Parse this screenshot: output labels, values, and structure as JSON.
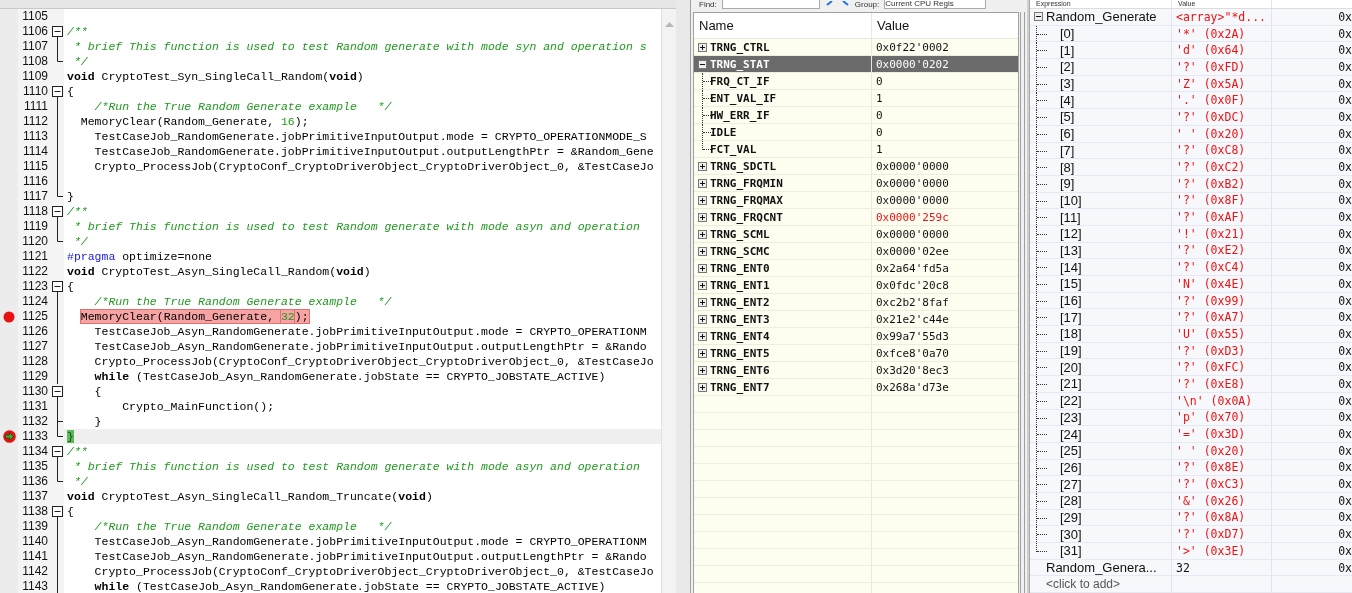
{
  "editor": {
    "lines": [
      {
        "number": "1105"
      },
      {
        "number": "1106",
        "fold": {
          "kind": "open"
        },
        "tokens": [
          {
            "kind": "comment",
            "text": "/**"
          }
        ]
      },
      {
        "number": "1107",
        "fold": {
          "kind": "line"
        },
        "tokens": [
          {
            "kind": "comment",
            "text": " * brief This function is used to test Random generate with mode syn and operation s"
          }
        ]
      },
      {
        "number": "1108",
        "fold": {
          "kind": "end"
        },
        "tokens": [
          {
            "kind": "comment",
            "text": " */"
          }
        ]
      },
      {
        "number": "1109",
        "tokens": [
          {
            "kind": "keyword",
            "text": "void"
          },
          {
            "kind": "plain",
            "text": " CryptoTest_Syn_SingleCall_Random("
          },
          {
            "kind": "keyword",
            "text": "void"
          },
          {
            "kind": "plain",
            "text": ")"
          }
        ]
      },
      {
        "number": "1110",
        "fold": {
          "kind": "open"
        },
        "tokens": [
          {
            "kind": "plain",
            "text": "{"
          }
        ]
      },
      {
        "number": "1111",
        "fold": {
          "kind": "line"
        },
        "tokens": [
          {
            "kind": "comment",
            "text": "    /*Run the True Random Generate example   */"
          }
        ]
      },
      {
        "number": "1112",
        "fold": {
          "kind": "line"
        },
        "tokens": [
          {
            "kind": "plain",
            "text": "  MemoryClear(Random_Generate, "
          },
          {
            "kind": "number",
            "text": "16"
          },
          {
            "kind": "plain",
            "text": ");"
          }
        ]
      },
      {
        "number": "1113",
        "fold": {
          "kind": "line"
        },
        "tokens": [
          {
            "kind": "plain",
            "text": "    TestCaseJob_RandomGenerate.jobPrimitiveInputOutput.mode = CRYPTO_OPERATIONMODE_S"
          }
        ]
      },
      {
        "number": "1114",
        "fold": {
          "kind": "line"
        },
        "tokens": [
          {
            "kind": "plain",
            "text": "    TestCaseJob_RandomGenerate.jobPrimitiveInputOutput.outputLengthPtr = &Random_Gene"
          }
        ]
      },
      {
        "number": "1115",
        "fold": {
          "kind": "line"
        },
        "tokens": [
          {
            "kind": "plain",
            "text": "    Crypto_ProcessJob(CryptoConf_CryptoDriverObject_CryptoDriverObject_0, &TestCaseJo"
          }
        ]
      },
      {
        "number": "1116",
        "fold": {
          "kind": "line"
        }
      },
      {
        "number": "1117",
        "fold": {
          "kind": "end"
        },
        "tokens": [
          {
            "kind": "plain",
            "text": "}"
          }
        ]
      },
      {
        "number": "1118",
        "fold": {
          "kind": "open"
        },
        "tokens": [
          {
            "kind": "comment",
            "text": "/**"
          }
        ]
      },
      {
        "number": "1119",
        "fold": {
          "kind": "line"
        },
        "tokens": [
          {
            "kind": "comment",
            "text": " * brief This function is used to test Random generate with mode asyn and operation"
          }
        ]
      },
      {
        "number": "1120",
        "fold": {
          "kind": "end"
        },
        "tokens": [
          {
            "kind": "comment",
            "text": " */"
          }
        ]
      },
      {
        "number": "1121",
        "tokens": [
          {
            "kind": "directive",
            "text": "#pragma"
          },
          {
            "kind": "plain",
            "text": " optimize=none"
          }
        ]
      },
      {
        "number": "1122",
        "tokens": [
          {
            "kind": "keyword",
            "text": "void"
          },
          {
            "kind": "plain",
            "text": " CryptoTest_Asyn_SingleCall_Random("
          },
          {
            "kind": "keyword",
            "text": "void"
          },
          {
            "kind": "plain",
            "text": ")"
          }
        ]
      },
      {
        "number": "1123",
        "fold": {
          "kind": "open"
        },
        "tokens": [
          {
            "kind": "plain",
            "text": "{"
          }
        ]
      },
      {
        "number": "1124",
        "fold": {
          "kind": "line"
        },
        "tokens": [
          {
            "kind": "comment",
            "text": "    /*Run the True Random Generate example   */"
          }
        ]
      },
      {
        "number": "1125",
        "fold": {
          "kind": "line"
        },
        "marker": {
          "kind": "breakpoint"
        },
        "tokens": [
          {
            "kind": "plain",
            "text": "  MemoryClear(Random_Generate, "
          },
          {
            "kind": "number",
            "text": "32"
          },
          {
            "kind": "plain",
            "text": ");"
          }
        ]
      },
      {
        "number": "1126",
        "fold": {
          "kind": "line"
        },
        "tokens": [
          {
            "kind": "plain",
            "text": "    TestCaseJob_Asyn_RandomGenerate.jobPrimitiveInputOutput.mode = CRYPTO_OPERATIONM"
          }
        ]
      },
      {
        "number": "1127",
        "fold": {
          "kind": "line"
        },
        "tokens": [
          {
            "kind": "plain",
            "text": "    TestCaseJob_Asyn_RandomGenerate.jobPrimitiveInputOutput.outputLengthPtr = &Rando"
          }
        ]
      },
      {
        "number": "1128",
        "fold": {
          "kind": "line"
        },
        "tokens": [
          {
            "kind": "plain",
            "text": "    Crypto_ProcessJob(CryptoConf_CryptoDriverObject_CryptoDriverObject_0, &TestCaseJo"
          }
        ]
      },
      {
        "number": "1129",
        "fold": {
          "kind": "line"
        },
        "tokens": [
          {
            "kind": "keyword",
            "text": "    while"
          },
          {
            "kind": "plain",
            "text": " (TestCaseJob_Asyn_RandomGenerate.jobState == CRYPTO_JOBSTATE_ACTIVE)"
          }
        ]
      },
      {
        "number": "1130",
        "fold": {
          "kind": "open"
        },
        "tokens": [
          {
            "kind": "plain",
            "text": "    {"
          }
        ]
      },
      {
        "number": "1131",
        "fold": {
          "kind": "line"
        },
        "tokens": [
          {
            "kind": "plain",
            "text": "        Crypto_MainFunction();"
          }
        ]
      },
      {
        "number": "1132",
        "fold": {
          "kind": "tee"
        },
        "tokens": [
          {
            "kind": "plain",
            "text": "    }"
          }
        ]
      },
      {
        "number": "1133",
        "fold": {
          "kind": "end"
        },
        "marker": {
          "kind": "current"
        },
        "tokens": [
          {
            "kind": "plain",
            "text": "}"
          }
        ]
      },
      {
        "number": "1134",
        "fold": {
          "kind": "open"
        },
        "tokens": [
          {
            "kind": "comment",
            "text": "/**"
          }
        ]
      },
      {
        "number": "1135",
        "fold": {
          "kind": "line"
        },
        "tokens": [
          {
            "kind": "comment",
            "text": " * brief This function is used to test Random generate with mode asyn and operation"
          }
        ]
      },
      {
        "number": "1136",
        "fold": {
          "kind": "end"
        },
        "tokens": [
          {
            "kind": "comment",
            "text": " */"
          }
        ]
      },
      {
        "number": "1137",
        "tokens": [
          {
            "kind": "keyword",
            "text": "void"
          },
          {
            "kind": "plain",
            "text": " CryptoTest_Asyn_SingleCall_Random_Truncate("
          },
          {
            "kind": "keyword",
            "text": "void"
          },
          {
            "kind": "plain",
            "text": ")"
          }
        ]
      },
      {
        "number": "1138",
        "fold": {
          "kind": "open"
        },
        "tokens": [
          {
            "kind": "plain",
            "text": "{"
          }
        ]
      },
      {
        "number": "1139",
        "fold": {
          "kind": "line"
        },
        "tokens": [
          {
            "kind": "comment",
            "text": "    /*Run the True Random Generate example   */"
          }
        ]
      },
      {
        "number": "1140",
        "fold": {
          "kind": "line"
        },
        "tokens": [
          {
            "kind": "plain",
            "text": "    TestCaseJob_Asyn_RandomGenerate.jobPrimitiveInputOutput.mode = CRYPTO_OPERATIONM"
          }
        ]
      },
      {
        "number": "1141",
        "fold": {
          "kind": "line"
        },
        "tokens": [
          {
            "kind": "plain",
            "text": "    TestCaseJob_Asyn_RandomGenerate.jobPrimitiveInputOutput.outputLengthPtr = &Rando"
          }
        ]
      },
      {
        "number": "1142",
        "fold": {
          "kind": "line"
        },
        "tokens": [
          {
            "kind": "plain",
            "text": "    Crypto_ProcessJob(CryptoConf_CryptoDriverObject_CryptoDriverObject_0, &TestCaseJo"
          }
        ]
      },
      {
        "number": "1143",
        "fold": {
          "kind": "line"
        },
        "tokens": [
          {
            "kind": "keyword",
            "text": "    while"
          },
          {
            "kind": "plain",
            "text": " (TestCaseJob_Asyn_RandomGenerate.jobState == CRYPTO_JOBSTATE_ACTIVE)"
          }
        ]
      }
    ]
  },
  "registers": {
    "find_label": "Find:",
    "group_label": "Group:",
    "group_value": "Current CPU Regis",
    "columns": [
      "Name",
      "Value"
    ],
    "rows": [
      {
        "name": "TRNG_CTRL",
        "value": "0x0f22'0002",
        "expanded": false,
        "selected": false,
        "changed": false
      },
      {
        "name": "TRNG_STAT",
        "value": "0x0000'0202",
        "expanded": true,
        "selected": true,
        "changed": false,
        "children": [
          {
            "name": "FRQ_CT_IF",
            "value": "0",
            "selected": false,
            "changed": false
          },
          {
            "name": "ENT_VAL_IF",
            "value": "1",
            "selected": false,
            "changed": false
          },
          {
            "name": "HW_ERR_IF",
            "value": "0",
            "selected": false,
            "changed": false
          },
          {
            "name": "IDLE",
            "value": "0",
            "selected": false,
            "changed": false
          },
          {
            "name": "FCT_VAL",
            "value": "1",
            "selected": false,
            "changed": false
          }
        ]
      },
      {
        "name": "TRNG_SDCTL",
        "value": "0x0000'0000",
        "expanded": false,
        "selected": false,
        "changed": false
      },
      {
        "name": "TRNG_FRQMIN",
        "value": "0x0000'0000",
        "expanded": false,
        "selected": false,
        "changed": false
      },
      {
        "name": "TRNG_FRQMAX",
        "value": "0x0000'0000",
        "expanded": false,
        "selected": false,
        "changed": false
      },
      {
        "name": "TRNG_FRQCNT",
        "value": "0x0000'259c",
        "expanded": false,
        "selected": false,
        "changed": true
      },
      {
        "name": "TRNG_SCML",
        "value": "0x0000'0000",
        "expanded": false,
        "selected": false,
        "changed": false
      },
      {
        "name": "TRNG_SCMC",
        "value": "0x0000'02ee",
        "expanded": false,
        "selected": false,
        "changed": false
      },
      {
        "name": "TRNG_ENT0",
        "value": "0x2a64'fd5a",
        "expanded": false,
        "selected": false,
        "changed": false
      },
      {
        "name": "TRNG_ENT1",
        "value": "0x0fdc'20c8",
        "expanded": false,
        "selected": false,
        "changed": false
      },
      {
        "name": "TRNG_ENT2",
        "value": "0xc2b2'8faf",
        "expanded": false,
        "selected": false,
        "changed": false
      },
      {
        "name": "TRNG_ENT3",
        "value": "0x21e2'c44e",
        "expanded": false,
        "selected": false,
        "changed": false
      },
      {
        "name": "TRNG_ENT4",
        "value": "0x99a7'55d3",
        "expanded": false,
        "selected": false,
        "changed": false
      },
      {
        "name": "TRNG_ENT5",
        "value": "0xfce8'0a70",
        "expanded": false,
        "selected": false,
        "changed": false
      },
      {
        "name": "TRNG_ENT6",
        "value": "0x3d20'8ec3",
        "expanded": false,
        "selected": false,
        "changed": false
      },
      {
        "name": "TRNG_ENT7",
        "value": "0x268a'd73e",
        "expanded": false,
        "selected": false,
        "changed": false
      }
    ]
  },
  "watch": {
    "columns": [
      "Expression",
      "Value"
    ],
    "rows": [
      {
        "expression": "Random_Generate",
        "value": "<array>\"*d...",
        "location": "0x",
        "expanded": true,
        "changed": true,
        "children": [
          {
            "expression": "[0]",
            "value": "'*' (0x2A)",
            "location": "0x",
            "changed": true
          },
          {
            "expression": "[1]",
            "value": "'d' (0x64)",
            "location": "0x",
            "changed": true
          },
          {
            "expression": "[2]",
            "value": "'?' (0xFD)",
            "location": "0x",
            "changed": true
          },
          {
            "expression": "[3]",
            "value": "'Z' (0x5A)",
            "location": "0x",
            "changed": true
          },
          {
            "expression": "[4]",
            "value": "'.' (0x0F)",
            "location": "0x",
            "changed": true
          },
          {
            "expression": "[5]",
            "value": "'?' (0xDC)",
            "location": "0x",
            "changed": true
          },
          {
            "expression": "[6]",
            "value": "' ' (0x20)",
            "location": "0x",
            "changed": true
          },
          {
            "expression": "[7]",
            "value": "'?' (0xC8)",
            "location": "0x",
            "changed": true
          },
          {
            "expression": "[8]",
            "value": "'?' (0xC2)",
            "location": "0x",
            "changed": true
          },
          {
            "expression": "[9]",
            "value": "'?' (0xB2)",
            "location": "0x",
            "changed": true
          },
          {
            "expression": "[10]",
            "value": "'?' (0x8F)",
            "location": "0x",
            "changed": true
          },
          {
            "expression": "[11]",
            "value": "'?' (0xAF)",
            "location": "0x",
            "changed": true
          },
          {
            "expression": "[12]",
            "value": "'!' (0x21)",
            "location": "0x",
            "changed": true
          },
          {
            "expression": "[13]",
            "value": "'?' (0xE2)",
            "location": "0x",
            "changed": true
          },
          {
            "expression": "[14]",
            "value": "'?' (0xC4)",
            "location": "0x",
            "changed": true
          },
          {
            "expression": "[15]",
            "value": "'N' (0x4E)",
            "location": "0x",
            "changed": true
          },
          {
            "expression": "[16]",
            "value": "'?' (0x99)",
            "location": "0x",
            "changed": true
          },
          {
            "expression": "[17]",
            "value": "'?' (0xA7)",
            "location": "0x",
            "changed": true
          },
          {
            "expression": "[18]",
            "value": "'U' (0x55)",
            "location": "0x",
            "changed": true
          },
          {
            "expression": "[19]",
            "value": "'?' (0xD3)",
            "location": "0x",
            "changed": true
          },
          {
            "expression": "[20]",
            "value": "'?' (0xFC)",
            "location": "0x",
            "changed": true
          },
          {
            "expression": "[21]",
            "value": "'?' (0xE8)",
            "location": "0x",
            "changed": true
          },
          {
            "expression": "[22]",
            "value": "'\\n' (0x0A)",
            "location": "0x",
            "changed": true
          },
          {
            "expression": "[23]",
            "value": "'p' (0x70)",
            "location": "0x",
            "changed": true
          },
          {
            "expression": "[24]",
            "value": "'=' (0x3D)",
            "location": "0x",
            "changed": true
          },
          {
            "expression": "[25]",
            "value": "' ' (0x20)",
            "location": "0x",
            "changed": true
          },
          {
            "expression": "[26]",
            "value": "'?' (0x8E)",
            "location": "0x",
            "changed": true
          },
          {
            "expression": "[27]",
            "value": "'?' (0xC3)",
            "location": "0x",
            "changed": true
          },
          {
            "expression": "[28]",
            "value": "'&' (0x26)",
            "location": "0x",
            "changed": true
          },
          {
            "expression": "[29]",
            "value": "'?' (0x8A)",
            "location": "0x",
            "changed": true
          },
          {
            "expression": "[30]",
            "value": "'?' (0xD7)",
            "location": "0x",
            "changed": true
          },
          {
            "expression": "[31]",
            "value": "'>' (0x3E)",
            "location": "0x",
            "changed": true
          }
        ]
      },
      {
        "expression": "Random_Genera...",
        "value": "32",
        "location": "0x",
        "changed": false
      }
    ],
    "add_placeholder": "<click to add>"
  }
}
